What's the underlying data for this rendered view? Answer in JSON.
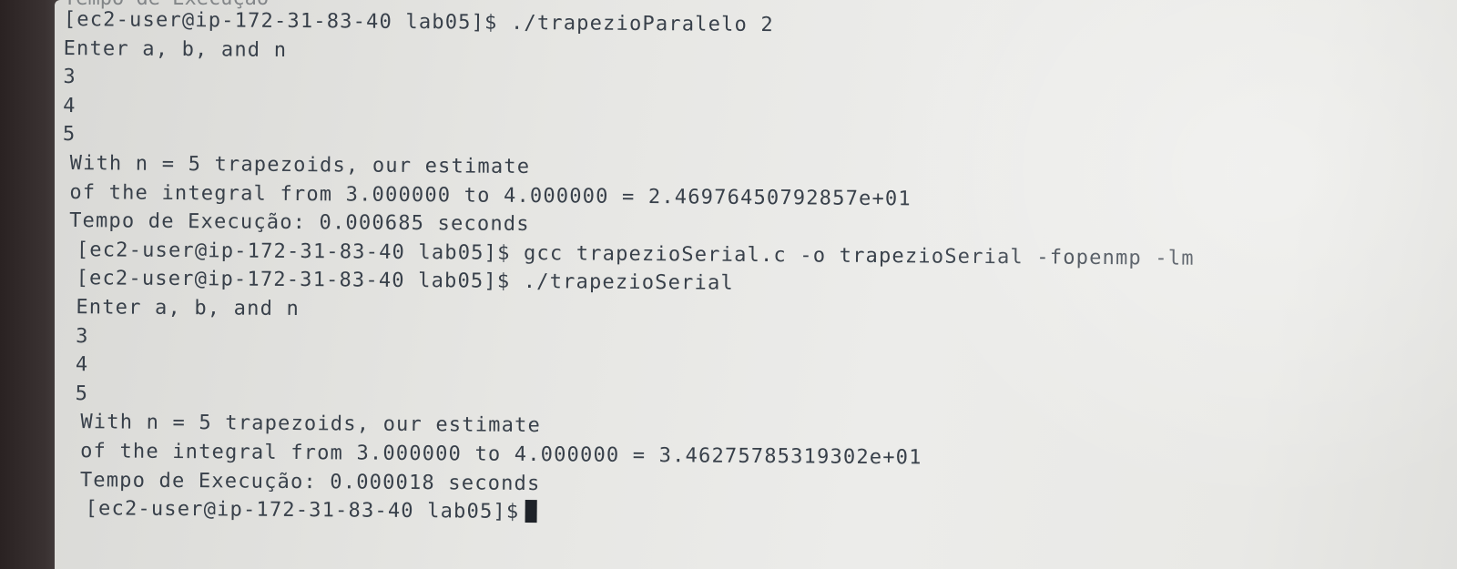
{
  "terminal": {
    "header_fragment": "Tempo de Execução",
    "lines": [
      "[ec2-user@ip-172-31-83-40 lab05]$ ./trapezioParalelo 2",
      "Enter a, b, and n",
      "3",
      "4",
      "5",
      "With n = 5 trapezoids, our estimate",
      "of the integral from 3.000000 to 4.000000 = 2.46976450792857e+01",
      "Tempo de Execução: 0.000685 seconds",
      "[ec2-user@ip-172-31-83-40 lab05]$ gcc trapezioSerial.c -o trapezioSerial -fopenmp -lm",
      "[ec2-user@ip-172-31-83-40 lab05]$ ./trapezioSerial",
      "Enter a, b, and n",
      "3",
      "4",
      "5",
      "With n = 5 trapezoids, our estimate",
      "of the integral from 3.000000 to 4.000000 = 3.46275785319302e+01",
      "Tempo de Execução: 0.000018 seconds"
    ],
    "prompt": "[ec2-user@ip-172-31-83-40 lab05]$"
  }
}
